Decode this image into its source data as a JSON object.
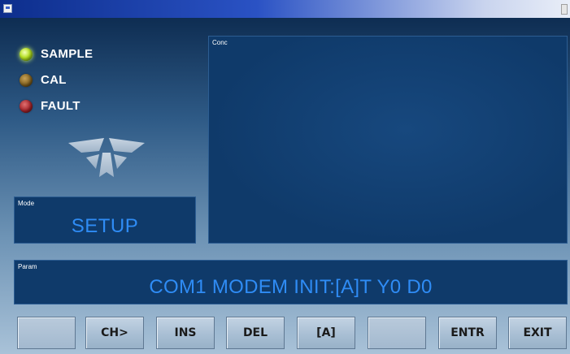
{
  "window": {
    "title": ""
  },
  "indicators": [
    {
      "label": "SAMPLE",
      "state": "on",
      "color": "#b6e025"
    },
    {
      "label": "CAL",
      "state": "off",
      "color": "#7c5c1c"
    },
    {
      "label": "FAULT",
      "state": "off",
      "color": "#a5242a"
    }
  ],
  "mode_panel": {
    "label": "Mode",
    "value": "SETUP"
  },
  "conc_panel": {
    "label": "Conc"
  },
  "param_panel": {
    "label": "Param",
    "value": "COM1 MODEM INIT:[A]T Y0 D0"
  },
  "keys": [
    "",
    "CH>",
    "INS",
    "DEL",
    "[A]",
    "",
    "ENTR",
    "EXIT"
  ],
  "colors": {
    "display_text": "#2f8cf5",
    "panel_bg": "#0f3a6a"
  }
}
